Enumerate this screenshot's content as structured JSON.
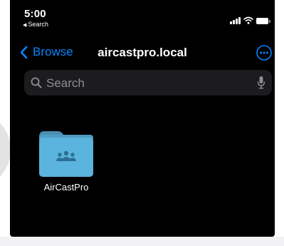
{
  "status_bar": {
    "time": "5:00",
    "back_app": "Search"
  },
  "nav": {
    "back_label": "Browse",
    "title": "aircastpro.local"
  },
  "search": {
    "placeholder": "Search"
  },
  "files": [
    {
      "name": "AirCastPro",
      "type": "folder",
      "icon": "shared-folder-icon"
    }
  ],
  "colors": {
    "accent": "#0a84ff",
    "background": "#000000",
    "search_bg": "#1c1c1e",
    "placeholder": "#8e8e93",
    "folder": "#5ab4de"
  }
}
